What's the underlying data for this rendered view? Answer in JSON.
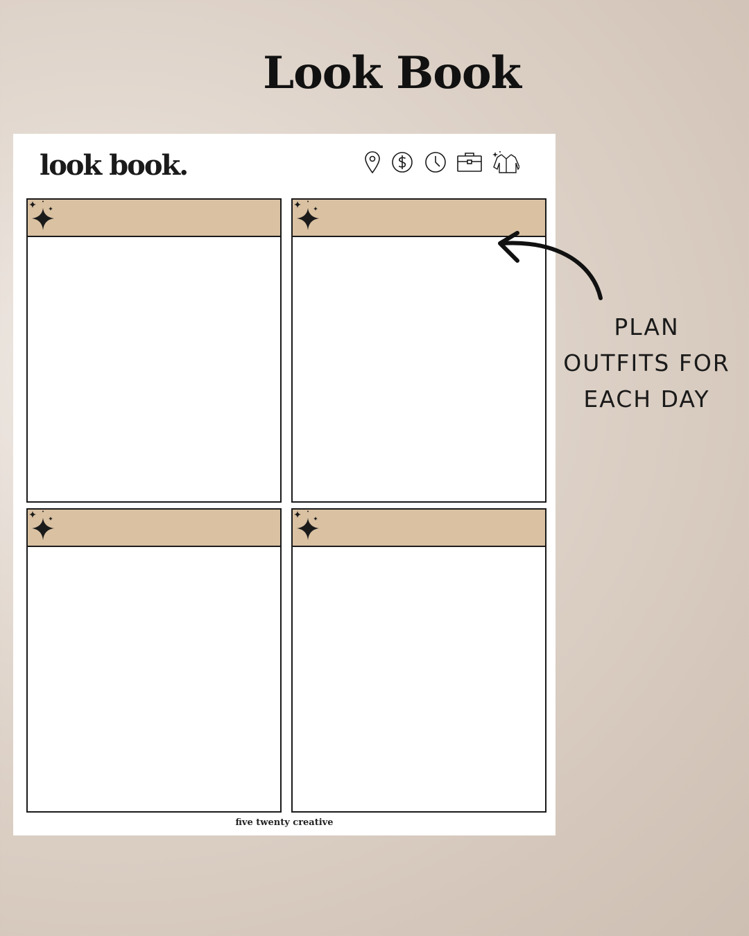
{
  "title": "Look Book",
  "sheet": {
    "title": "look book.",
    "footer": "five twenty creative",
    "header_icons": [
      "location-pin-icon",
      "dollar-icon",
      "clock-icon",
      "briefcase-icon",
      "outfit-icon"
    ],
    "cards": [
      {
        "id": "card-1",
        "decor": "sparkle-icon"
      },
      {
        "id": "card-2",
        "decor": "sparkle-icon"
      },
      {
        "id": "card-3",
        "decor": "sparkle-icon"
      },
      {
        "id": "card-4",
        "decor": "sparkle-icon"
      }
    ]
  },
  "callout": {
    "lines": [
      "PLAN",
      "OUTFITS FOR",
      "EACH DAY"
    ]
  },
  "colors": {
    "header_band": "#d9c1a2",
    "border": "#1a1a1a",
    "background": "#d5c7bb"
  }
}
